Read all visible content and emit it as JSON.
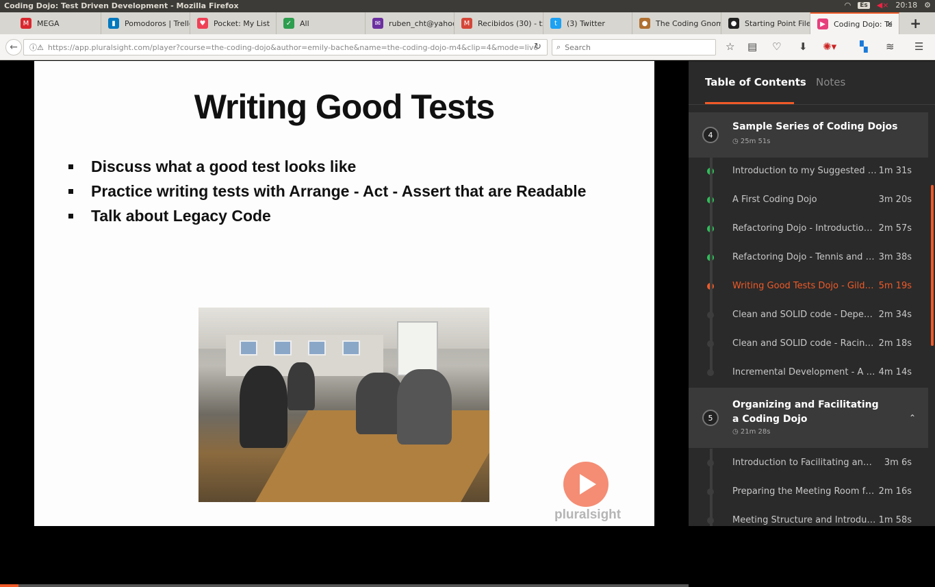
{
  "os": {
    "title": "Coding Dojo: Test Driven Development - Mozilla Firefox",
    "kbd": "Es",
    "clock": "20:18"
  },
  "tabs": [
    {
      "label": "MEGA",
      "color": "#d9272e",
      "glyph": "M"
    },
    {
      "label": "Pomodoros | Trello",
      "color": "#0079bf",
      "glyph": "▮"
    },
    {
      "label": "Pocket: My List",
      "color": "#ef4056",
      "glyph": "♥"
    },
    {
      "label": "All",
      "color": "#2e9e4f",
      "glyph": "✓"
    },
    {
      "label": "ruben_cht@yahoo",
      "color": "#6b2fa0",
      "glyph": "✉"
    },
    {
      "label": "Recibidos (30) - tx",
      "color": "#d44638",
      "glyph": "M"
    },
    {
      "label": "(3) Twitter",
      "color": "#1da1f2",
      "glyph": "t"
    },
    {
      "label": "The Coding Gnome",
      "color": "#b07030",
      "glyph": "●"
    },
    {
      "label": "Starting Point File",
      "color": "#222222",
      "glyph": "●"
    },
    {
      "label": "Coding Dojo: Te",
      "color": "#e73f7c",
      "glyph": "▶"
    }
  ],
  "nav": {
    "url": "https://app.pluralsight.com/player?course=the-coding-dojo&author=emily-bache&name=the-coding-dojo-m4&clip=4&mode=live",
    "search_placeholder": "Search"
  },
  "slide": {
    "title": "Writing Good Tests",
    "bullets": [
      "Discuss what a good test looks like",
      "Practice writing tests with Arrange - Act - Assert that are Readable",
      "Talk about Legacy Code"
    ],
    "brand": "pluralsight"
  },
  "progress": 0.027,
  "panel": {
    "tab_toc": "Table of Contents",
    "tab_notes": "Notes",
    "module4": {
      "num": "4",
      "title": "Sample Series of Coding Dojos",
      "duration": "25m 51s"
    },
    "clips4": [
      {
        "title": "Introduction to my Suggested Se...",
        "duration": "1m 31s",
        "state": "done"
      },
      {
        "title": "A First Coding Dojo",
        "duration": "3m 20s",
        "state": "done"
      },
      {
        "title": "Refactoring Dojo - Introduction ...",
        "duration": "2m 57s",
        "state": "done"
      },
      {
        "title": "Refactoring Dojo - Tennis and Y...",
        "duration": "3m 38s",
        "state": "done"
      },
      {
        "title": "Writing Good Tests Dojo - Gilded...",
        "duration": "5m 19s",
        "state": "current"
      },
      {
        "title": "Clean and SOLID code - Depen...",
        "duration": "2m 34s",
        "state": "todo"
      },
      {
        "title": "Clean and SOLID code - Racing ...",
        "duration": "2m 18s",
        "state": "todo"
      },
      {
        "title": "Incremental Development - A C...",
        "duration": "4m 14s",
        "state": "todo"
      }
    ],
    "module5": {
      "num": "5",
      "title_line1": "Organizing and Facilitating",
      "title_line2": "a Coding Dojo",
      "duration": "21m 28s"
    },
    "clips5": [
      {
        "title": "Introduction to Facilitating and O...",
        "duration": "3m 6s",
        "state": "todo"
      },
      {
        "title": "Preparing the Meeting Room for...",
        "duration": "2m 16s",
        "state": "todo"
      },
      {
        "title": "Meeting Structure and Introducti...",
        "duration": "1m 58s",
        "state": "todo"
      }
    ]
  }
}
